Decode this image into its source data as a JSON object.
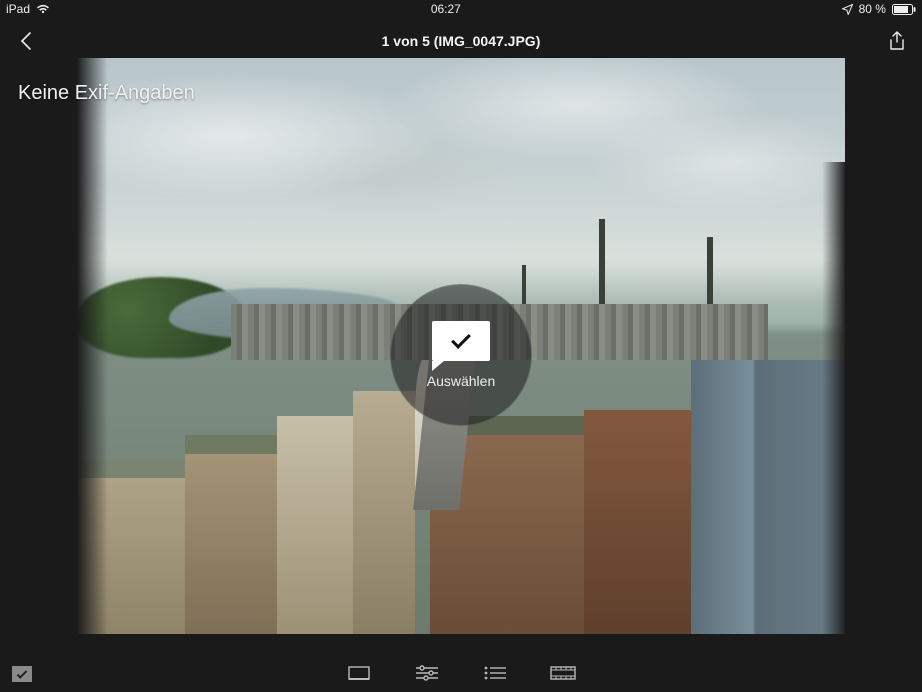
{
  "status": {
    "device": "iPad",
    "time": "06:27",
    "battery_percent": "80 %"
  },
  "header": {
    "title": "1 von 5 (IMG_0047.JPG)"
  },
  "exif": {
    "label": "Keine Exif-Angaben"
  },
  "overlay": {
    "select_label": "Auswählen"
  }
}
